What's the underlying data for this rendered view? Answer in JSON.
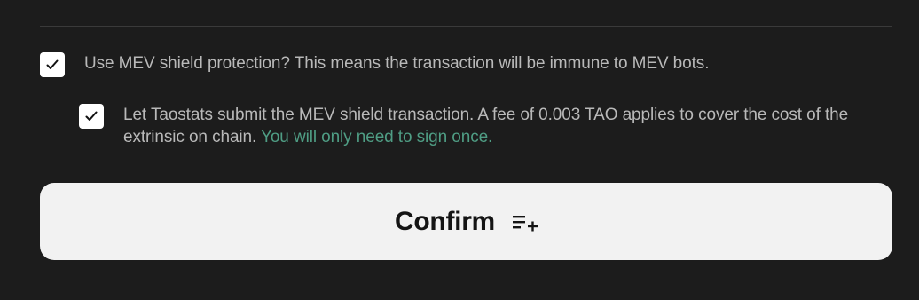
{
  "mev_shield": {
    "checked": true,
    "label": "Use MEV shield protection? This means the transaction will be immune to MEV bots."
  },
  "taostats_submit": {
    "checked": true,
    "label_main": "Let Taostats submit the MEV shield transaction. A fee of 0.003 TAO applies to cover the cost of the extrinsic on chain. ",
    "label_highlight": "You will only need to sign once."
  },
  "confirm_button": {
    "label": "Confirm",
    "icon": "playlist-add-icon"
  },
  "colors": {
    "background": "#1c1c1c",
    "text": "#b9b9b9",
    "highlight": "#4f9d84",
    "button_bg": "#f2f2f2",
    "button_text": "#141414"
  }
}
